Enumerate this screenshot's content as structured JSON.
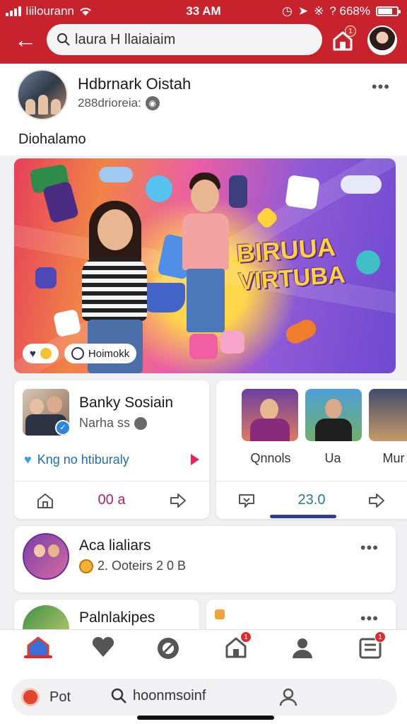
{
  "status": {
    "carrier": "Iiilourann",
    "time": "33 AM",
    "battery": "? 668%"
  },
  "header": {
    "search_value": "laura H llaiaiaim",
    "home_badge": "1"
  },
  "profile": {
    "name": "Hdbrnark Oistah",
    "subtitle": "288drioreia:",
    "caption": "Diohalamo"
  },
  "banner": {
    "title_line1": "BIRUUA",
    "title_line2": "VIRTUBA",
    "chip_text": "Hoimokk"
  },
  "friend_card": {
    "name": "Banky Sosiain",
    "subtitle": "Narha ss",
    "link": "Kng no htiburaly",
    "count": "00 a"
  },
  "stories": {
    "labels": [
      "Qnnols",
      "Ua",
      "Mur"
    ],
    "count": "23.0"
  },
  "group_card": {
    "name": "Aca lialiars",
    "subtitle": "2. Ooteirs 2 0 B"
  },
  "partial_card": {
    "name": "Palnlakipes"
  },
  "bottom_nav": {
    "badges": [
      "1",
      "1",
      "1"
    ]
  },
  "bottom_bar": {
    "post_label": "Pot",
    "search_value": "hoonmsoinf"
  },
  "colors": {
    "brand_red": "#c8232c",
    "link_blue": "#1d6fb8"
  }
}
